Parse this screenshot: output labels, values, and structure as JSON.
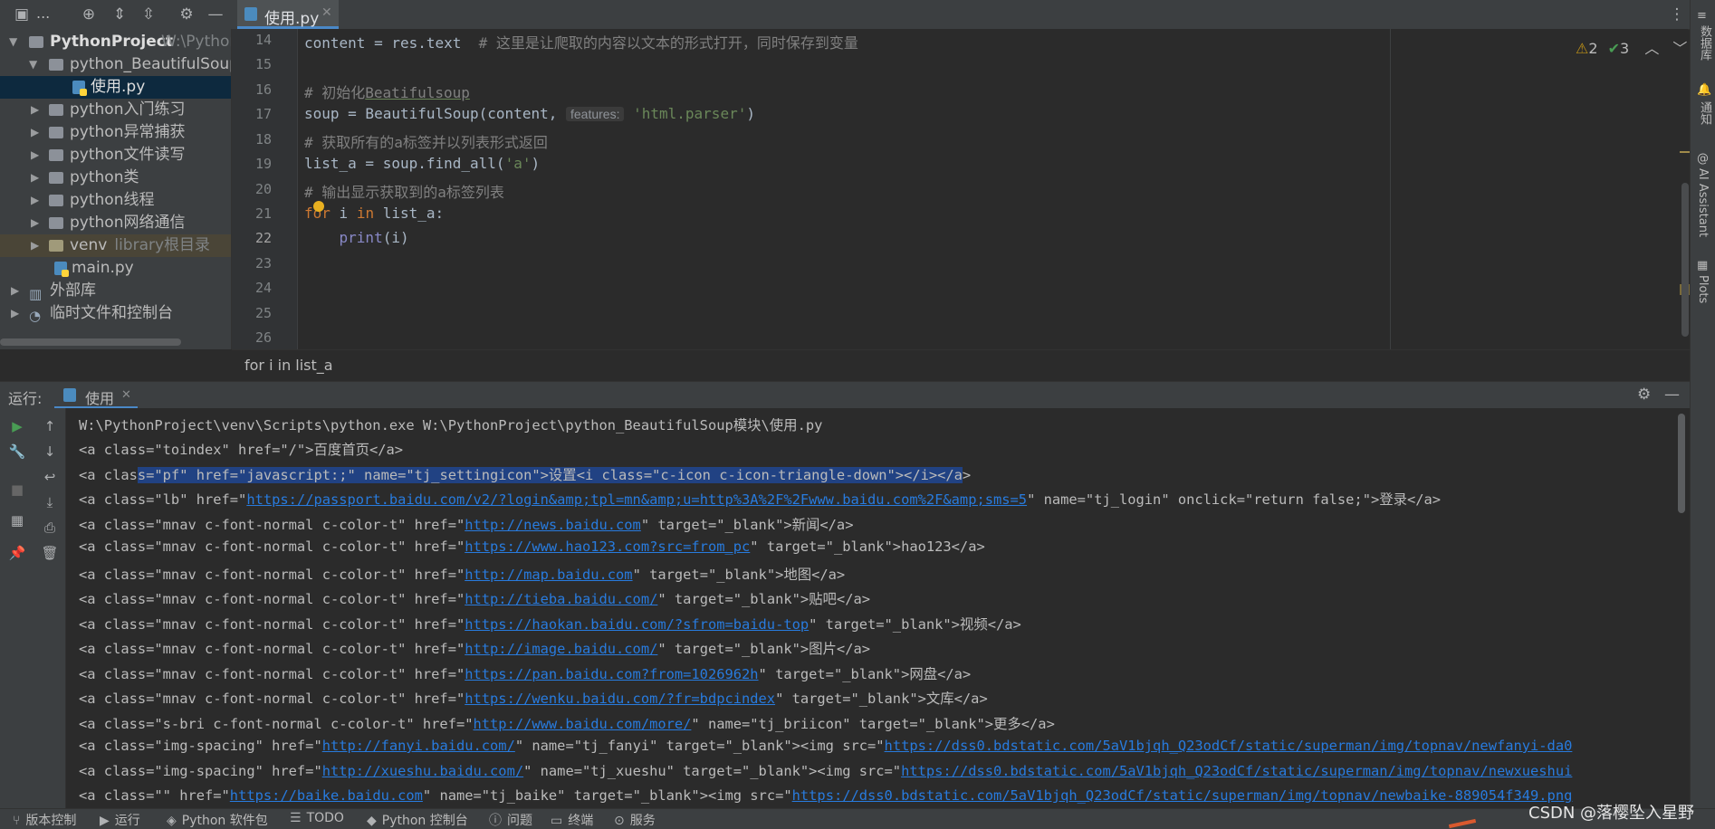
{
  "toolbar": {
    "project_dropdown": "...",
    "file_tab": "使用.py"
  },
  "tree": {
    "root_name": "PythonProject",
    "root_path": "W:\\Pythor",
    "items": [
      {
        "label": "python_BeautifulSoup模"
      },
      {
        "label": "使用.py"
      },
      {
        "label": "python入门练习"
      },
      {
        "label": "python异常捕获"
      },
      {
        "label": "python文件读写"
      },
      {
        "label": "python类"
      },
      {
        "label": "python线程"
      },
      {
        "label": "python网络通信"
      },
      {
        "label": "venv",
        "suffix": "library根目录"
      },
      {
        "label": "main.py"
      },
      {
        "label": "外部库"
      },
      {
        "label": "临时文件和控制台"
      }
    ]
  },
  "editor": {
    "line_numbers": [
      "14",
      "15",
      "16",
      "17",
      "18",
      "19",
      "20",
      "21",
      "22",
      "23",
      "24",
      "25",
      "26"
    ],
    "lines": {
      "l14_code": "content = res.text  ",
      "l14_comment": "# 这里是让爬取的内容以文本的形式打开，同时保存到变量",
      "l16_comment": "# 初始化",
      "l16_word": "Beatifulsoup",
      "l17_code": "soup = BeautifulSoup(content, ",
      "l17_hint": "features:",
      "l17_str": "'html.parser'",
      "l17_end": ")",
      "l18_comment": "# 获取所有的a标签并以列表形式返回",
      "l19_code": "list_a = soup.find_all(",
      "l19_str": "'a'",
      "l19_end": ")",
      "l20_comment": "# 输出显示获取到的a标签列表",
      "l21_kw1": "for",
      "l21_mid": " i ",
      "l21_kw2": "in",
      "l21_end": " list_a:",
      "l22_indent": "    ",
      "l22_fn": "print",
      "l22_args": "(i)"
    },
    "inspections": {
      "warnings": "2",
      "ok": "3"
    },
    "breadcrumb": "for i in list_a"
  },
  "sidebar_right": {
    "db": "数据库",
    "notify": "通知",
    "ai": "AI Assistant",
    "plots": "Plots"
  },
  "run": {
    "label": "运行:",
    "tab": "使用",
    "lines": [
      {
        "parts": [
          {
            "t": "W:\\PythonProject\\venv\\Scripts\\python.exe W:\\PythonProject\\python_BeautifulSoup模块\\使用.py"
          }
        ]
      },
      {
        "parts": [
          {
            "t": "<a class=\"toindex\" href=\"/\">百度首页</a>"
          }
        ]
      },
      {
        "parts": [
          {
            "t": "<a clas"
          },
          {
            "t": "s=\"pf\" href=\"javascript:;\" name=\"tj_settingicon\">设置<i class=\"c-icon c-icon-triangle-down\"></i></a",
            "s": 1
          },
          {
            "t": ">"
          }
        ]
      },
      {
        "parts": [
          {
            "t": "<a class=\"lb\" href=\""
          },
          {
            "t": "https://passport.baidu.com/v2/?login&amp;tpl=mn&amp;u=http%3A%2F%2Fwww.baidu.com%2F&amp;sms=5",
            "l": 1
          },
          {
            "t": "\" name=\"tj_login\" onclick=\"return false;\">登录</a>"
          }
        ]
      },
      {
        "parts": [
          {
            "t": "<a class=\"mnav c-font-normal c-color-t\" href=\""
          },
          {
            "t": "http://news.baidu.com",
            "l": 1
          },
          {
            "t": "\" target=\"_blank\">新闻</a>"
          }
        ]
      },
      {
        "parts": [
          {
            "t": "<a class=\"mnav c-font-normal c-color-t\" href=\""
          },
          {
            "t": "https://www.hao123.com?src=from_pc",
            "l": 1
          },
          {
            "t": "\" target=\"_blank\">hao123</a>"
          }
        ]
      },
      {
        "parts": [
          {
            "t": "<a class=\"mnav c-font-normal c-color-t\" href=\""
          },
          {
            "t": "http://map.baidu.com",
            "l": 1
          },
          {
            "t": "\" target=\"_blank\">地图</a>"
          }
        ]
      },
      {
        "parts": [
          {
            "t": "<a class=\"mnav c-font-normal c-color-t\" href=\""
          },
          {
            "t": "http://tieba.baidu.com/",
            "l": 1
          },
          {
            "t": "\" target=\"_blank\">贴吧</a>"
          }
        ]
      },
      {
        "parts": [
          {
            "t": "<a class=\"mnav c-font-normal c-color-t\" href=\""
          },
          {
            "t": "https://haokan.baidu.com/?sfrom=baidu-top",
            "l": 1
          },
          {
            "t": "\" target=\"_blank\">视频</a>"
          }
        ]
      },
      {
        "parts": [
          {
            "t": "<a class=\"mnav c-font-normal c-color-t\" href=\""
          },
          {
            "t": "http://image.baidu.com/",
            "l": 1
          },
          {
            "t": "\" target=\"_blank\">图片</a>"
          }
        ]
      },
      {
        "parts": [
          {
            "t": "<a class=\"mnav c-font-normal c-color-t\" href=\""
          },
          {
            "t": "https://pan.baidu.com?from=1026962h",
            "l": 1
          },
          {
            "t": "\" target=\"_blank\">网盘</a>"
          }
        ]
      },
      {
        "parts": [
          {
            "t": "<a class=\"mnav c-font-normal c-color-t\" href=\""
          },
          {
            "t": "https://wenku.baidu.com/?fr=bdpcindex",
            "l": 1
          },
          {
            "t": "\" target=\"_blank\">文库</a>"
          }
        ]
      },
      {
        "parts": [
          {
            "t": "<a class=\"s-bri c-font-normal c-color-t\" href=\""
          },
          {
            "t": "http://www.baidu.com/more/",
            "l": 1
          },
          {
            "t": "\" name=\"tj_briicon\" target=\"_blank\">更多</a>"
          }
        ]
      },
      {
        "parts": [
          {
            "t": "<a class=\"img-spacing\" href=\""
          },
          {
            "t": "http://fanyi.baidu.com/",
            "l": 1
          },
          {
            "t": "\" name=\"tj_fanyi\" target=\"_blank\"><img src=\""
          },
          {
            "t": "https://dss0.bdstatic.com/5aV1bjqh_Q23odCf/static/superman/img/topnav/newfanyi-da0",
            "l": 1
          }
        ]
      },
      {
        "parts": [
          {
            "t": "<a class=\"img-spacing\" href=\""
          },
          {
            "t": "http://xueshu.baidu.com/",
            "l": 1
          },
          {
            "t": "\" name=\"tj_xueshu\" target=\"_blank\"><img src=\""
          },
          {
            "t": "https://dss0.bdstatic.com/5aV1bjqh_Q23odCf/static/superman/img/topnav/newxueshui",
            "l": 1
          }
        ]
      },
      {
        "parts": [
          {
            "t": "<a class=\"\" href=\""
          },
          {
            "t": "https://baike.baidu.com",
            "l": 1
          },
          {
            "t": "\" name=\"tj_baike\" target=\"_blank\"><img src=\""
          },
          {
            "t": "https://dss0.bdstatic.com/5aV1bjqh_Q23odCf/static/superman/img/topnav/newbaike-889054f349.png",
            "l": 1
          }
        ]
      }
    ]
  },
  "status": {
    "vcs": "版本控制",
    "run": "运行",
    "packages": "Python 软件包",
    "todo": "TODO",
    "console": "Python 控制台",
    "problems": "问题",
    "terminal": "终端",
    "services": "服务"
  },
  "watermark": "CSDN @落樱坠入星野",
  "colors": {
    "accent": "#4a88c7",
    "link": "#287bde",
    "selection": "#214283",
    "comment": "#808080",
    "string": "#6a8759",
    "keyword": "#cc7832"
  }
}
